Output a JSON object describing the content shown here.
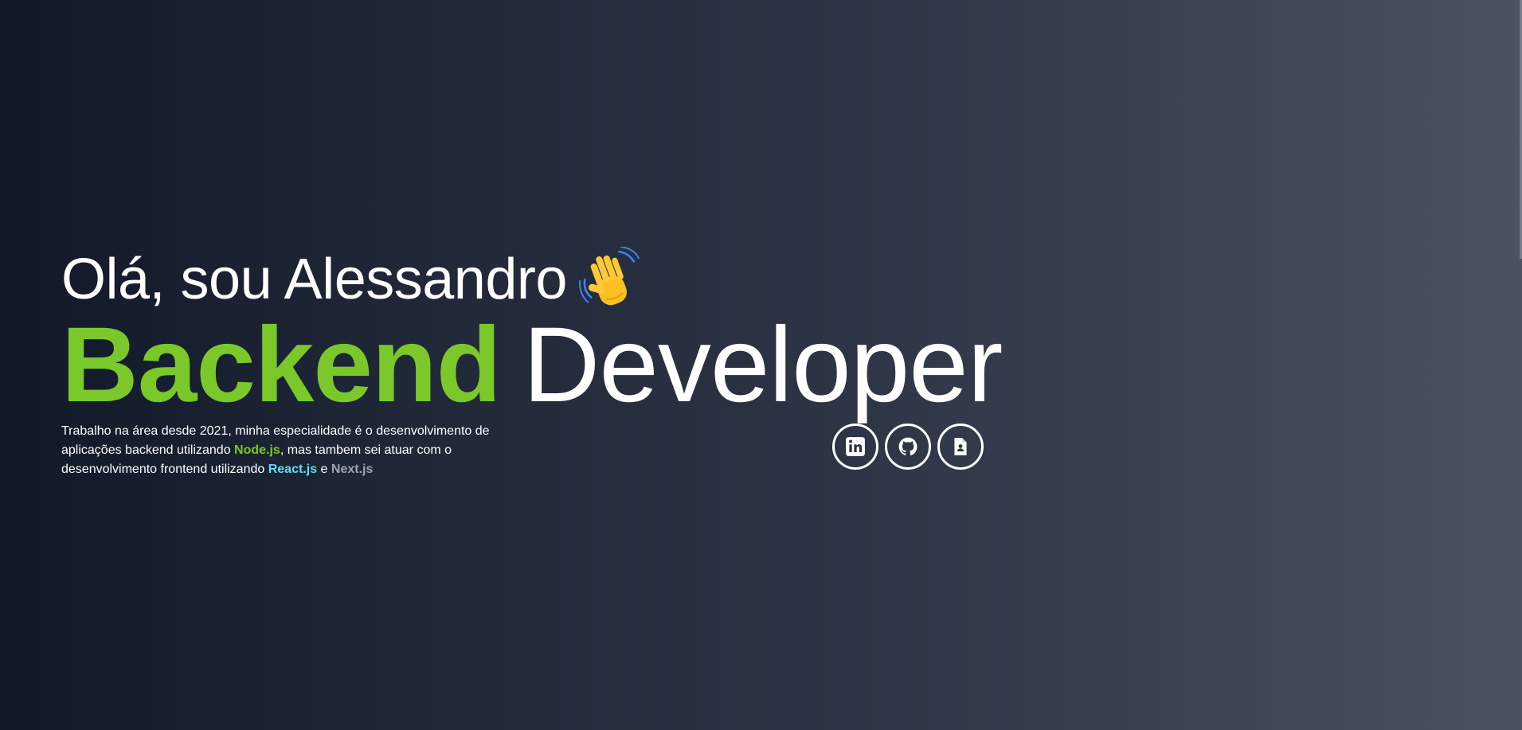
{
  "hero": {
    "greeting": "Olá, sou Alessandro",
    "wave_icon": "waving-hand-emoji",
    "title_accent": "Backend",
    "title_rest": "Developer",
    "description": {
      "part1": "Trabalho na área desde 2021, minha especialidade é o desenvolvimento de aplicações backend utilizando ",
      "node": "Node.js",
      "part2": ", mas tambem sei atuar com o desenvolvimento frontend utilizando ",
      "react": "React.js",
      "part3": " e ",
      "next": "Next.js"
    }
  },
  "socials": [
    {
      "name": "linkedin",
      "icon": "linkedin-icon"
    },
    {
      "name": "github",
      "icon": "github-icon"
    },
    {
      "name": "resume",
      "icon": "resume-document-icon"
    }
  ],
  "colors": {
    "accent_green": "#7ac82a",
    "react_blue": "#61dafb",
    "next_gray": "#9ca3af",
    "text": "#ffffff",
    "bg_start": "#111827",
    "bg_end": "#4b5262"
  }
}
